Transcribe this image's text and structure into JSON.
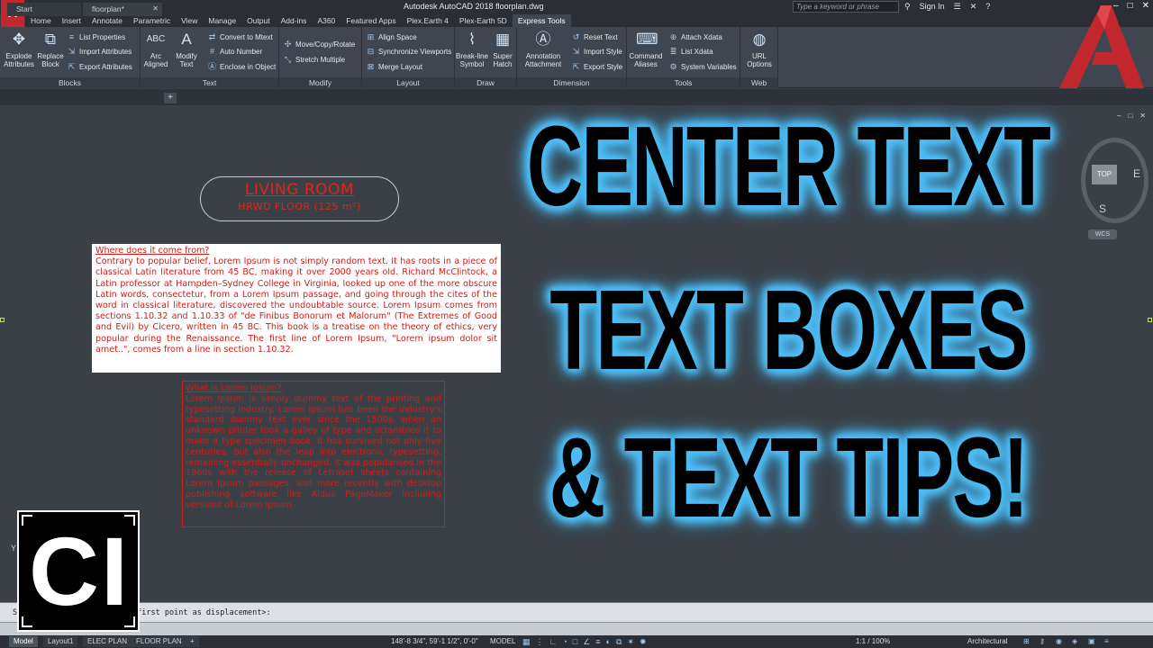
{
  "titlebar": {
    "app_logo": "A",
    "title": "Autodesk AutoCAD 2018   floorplan.dwg",
    "search_placeholder": "Type a keyword or phrase",
    "sign_in": "Sign In",
    "qat_icons": [
      "new-icon",
      "open-icon",
      "save-icon",
      "saveas-icon",
      "print-icon",
      "undo-icon",
      "redo-icon"
    ]
  },
  "ribbon_tabs": [
    "Home",
    "Insert",
    "Annotate",
    "Parametric",
    "View",
    "Manage",
    "Output",
    "Add-ins",
    "A360",
    "Featured Apps",
    "Plex.Earth 4",
    "Plex-Earth 5D",
    "Express Tools"
  ],
  "ribbon": {
    "blocks": {
      "label": "Blocks",
      "explode": "Explode Attributes",
      "replace": "Replace Block",
      "list_properties": "List Properties",
      "import_attributes": "Import Attributes",
      "export_attributes": "Export Attributes"
    },
    "text": {
      "label": "Text",
      "arc_aligned": "Arc Aligned",
      "modify_text": "Modify Text",
      "convert_mtext": "Convert to Mtext",
      "auto_number": "Auto Number",
      "enclose": "Enclose in Object"
    },
    "modify": {
      "label": "Modify",
      "move_copy_rotate": "Move/Copy/Rotate",
      "stretch_multiple": "Stretch Multiple"
    },
    "layout": {
      "label": "Layout",
      "align_space": "Align Space",
      "sync_viewports": "Synchronize Viewports",
      "merge_layout": "Merge Layout"
    },
    "draw": {
      "label": "Draw",
      "breakline": "Break-line Symbol",
      "super_hatch": "Super Hatch"
    },
    "dimension": {
      "label": "Dimension",
      "annotation_attachment": "Annotation Attachment",
      "reset_text": "Reset Text",
      "import_style": "Import Style",
      "export_style": "Export Style"
    },
    "tools": {
      "label": "Tools",
      "command_aliases": "Command Aliases",
      "attach_xdata": "Attach Xdata",
      "list_xdata": "List Xdata",
      "system_variables": "System Variables"
    },
    "web": {
      "label": "Web",
      "url_options": "URL Options"
    }
  },
  "doc_tabs": [
    "Start",
    "floorplan*"
  ],
  "drawing": {
    "room_title": "LIVING ROOM",
    "room_sub": "HRWD FLOOR (125 m²)",
    "mtext1_heading": "Where does it come from?",
    "mtext1_body": "Contrary to popular belief, Lorem Ipsum is not simply random text. It has roots in a piece of classical Latin literature from 45 BC, making it over 2000 years old. Richard McClintock, a Latin professor at Hampden–Sydney College in Virginia, looked up one of the more obscure Latin words, consectetur, from a Lorem Ipsum passage, and going through the cites of the word in classical literature, discovered the undoubtable source. Lorem Ipsum comes from sections 1.10.32 and 1.10.33 of \"de Finibus Bonorum et Malorum\" (The Extremes of Good and Evil) by Cicero, written in 45 BC. This book is a treatise on the theory of ethics, very popular during the Renaissance. The first line of Lorem Ipsum, \"Lorem ipsum dolor sit amet..\", comes from a line in section 1.10.32.",
    "mtext2_heading": "What is Lorem Ipsum?",
    "mtext2_body": "Lorem Ipsum is simply dummy text of the printing and typesetting industry. Lorem Ipsum has been the industry's standard dummy text ever since the 1500s, when an unknown printer took a galley of type and scrambled it to make a type specimen book. It has survived not only five centuries, but also the leap into electronic typesetting, remaining essentially unchanged. It was popularised in the 1960s with the release of Letraset sheets containing Lorem Ipsum passages, and more recently with desktop publishing software like Aldus PageMaker including versions of Lorem Ipsum."
  },
  "viewcube": {
    "top": "TOP",
    "east": "E",
    "south": "S",
    "wcs": "WCS"
  },
  "overlay": {
    "line1": "CENTER TEXT",
    "line2": "TEXT BOXES",
    "line3": "& TEXT TIPS!",
    "glow_color": "#4fbef5"
  },
  "logo": {
    "text": "CI"
  },
  "command": {
    "prompt": "Specify base point or <use first point as displacement>:"
  },
  "statusbar": {
    "tabs": [
      "Model",
      "Layout1",
      "ELEC PLAN",
      "FLOOR PLAN"
    ],
    "coords": "148'-8 3/4\", 59'-1 1/2\", 0'-0\"",
    "mode": "MODEL",
    "scale": "1:1 / 100%",
    "units": "Architectural"
  },
  "colors": {
    "drawing_bg": "#3b4046",
    "ribbon_bg": "#3f4650",
    "text_red": "#d61a16",
    "autocad_red": "#c1272d"
  }
}
